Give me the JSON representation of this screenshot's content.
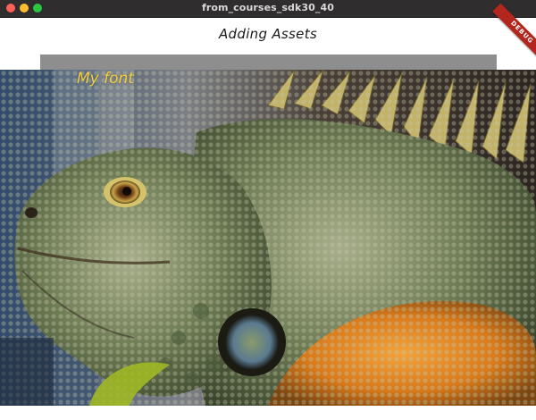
{
  "window": {
    "title": "from_courses_sdk30_40"
  },
  "appbar": {
    "title": "Adding Assets"
  },
  "debug_banner": {
    "label": "DEBUG"
  },
  "asset_image": {
    "subject": "iguana",
    "font_sample_text": "My font",
    "font_sample_color": "#f4d03f"
  },
  "colors": {
    "titlebar_bg": "#2f2d2d",
    "close": "#fe5f57",
    "minimize": "#febc2e",
    "maximize": "#28c840",
    "strip": "#8e8e8e",
    "banner": "#b3261e"
  }
}
